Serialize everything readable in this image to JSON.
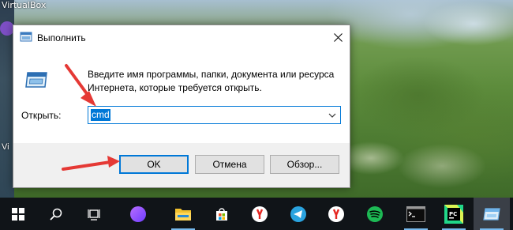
{
  "desktop": {
    "window_label": "VirtualBox",
    "side_label": "Vi"
  },
  "dialog": {
    "title": "Выполнить",
    "description": "Введите имя программы, папки, документа или ресурса Интернета, которые требуется открыть.",
    "open_label": "Открыть:",
    "combo_value": "cmd",
    "buttons": {
      "ok": "OK",
      "cancel": "Отмена",
      "browse": "Обзор..."
    }
  },
  "taskbar": {
    "items": [
      {
        "name": "start",
        "icon": "windows-icon"
      },
      {
        "name": "search",
        "icon": "search-icon"
      },
      {
        "name": "task-view",
        "icon": "task-view-icon"
      },
      {
        "name": "alice",
        "icon": "alice-icon"
      },
      {
        "name": "explorer",
        "icon": "folder-icon"
      },
      {
        "name": "store",
        "icon": "store-icon"
      },
      {
        "name": "yandex-browser",
        "icon": "yandex-icon"
      },
      {
        "name": "telegram",
        "icon": "telegram-icon"
      },
      {
        "name": "yandex-browser-2",
        "icon": "yandex-icon"
      },
      {
        "name": "spotify",
        "icon": "spotify-icon"
      },
      {
        "name": "terminal",
        "icon": "terminal-icon"
      },
      {
        "name": "pycharm",
        "icon": "pycharm-icon",
        "text": "PC"
      },
      {
        "name": "run",
        "icon": "run-icon"
      }
    ]
  },
  "colors": {
    "accent": "#0078d7",
    "arrow": "#e53935",
    "taskbar": "#101418"
  }
}
